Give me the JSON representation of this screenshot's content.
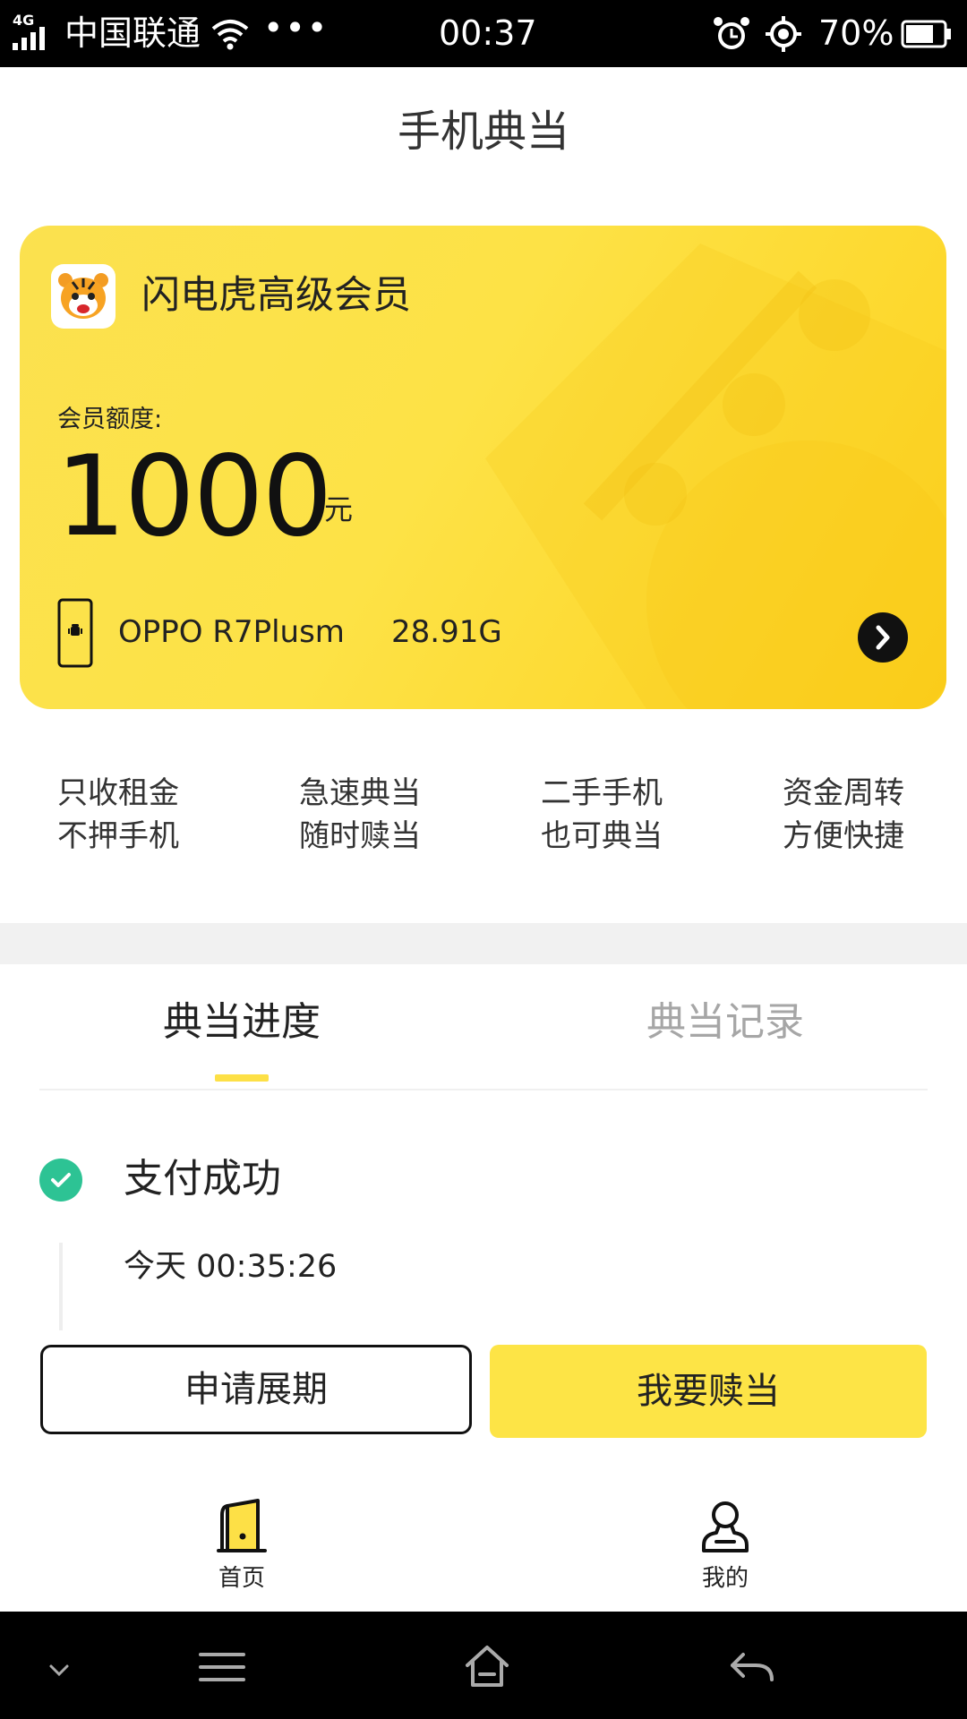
{
  "status_bar": {
    "network": "4G",
    "carrier": "中国联通",
    "more": "•••",
    "time": "00:37",
    "battery": "70%"
  },
  "page": {
    "title": "手机典当"
  },
  "card": {
    "member_title": "闪电虎高级会员",
    "quota_label": "会员额度:",
    "quota_value": "1000",
    "quota_unit": "元",
    "phone_model": "OPPO R7Plusm",
    "phone_storage": "28.91G",
    "colors": {
      "start": "#fbe14f",
      "end": "#fdd21e"
    }
  },
  "features": [
    {
      "line1": "只收租金",
      "line2": "不押手机"
    },
    {
      "line1": "急速典当",
      "line2": "随时赎当"
    },
    {
      "line1": "二手手机",
      "line2": "也可典当"
    },
    {
      "line1": "资金周转",
      "line2": "方便快捷"
    }
  ],
  "tabs": [
    {
      "label": "典当进度",
      "active": true
    },
    {
      "label": "典当记录",
      "active": false
    }
  ],
  "progress": {
    "status": "支付成功",
    "time": "今天 00:35:26",
    "status_color": "#2dc394"
  },
  "actions": {
    "extend_label": "申请展期",
    "redeem_label": "我要赎当",
    "accent": "#fde446"
  },
  "bottom_nav": [
    {
      "label": "首页",
      "icon": "home-phone-icon"
    },
    {
      "label": "我的",
      "icon": "profile-icon"
    }
  ],
  "system_nav": [
    "chevron-down-icon",
    "menu-icon",
    "home-icon",
    "back-icon"
  ]
}
